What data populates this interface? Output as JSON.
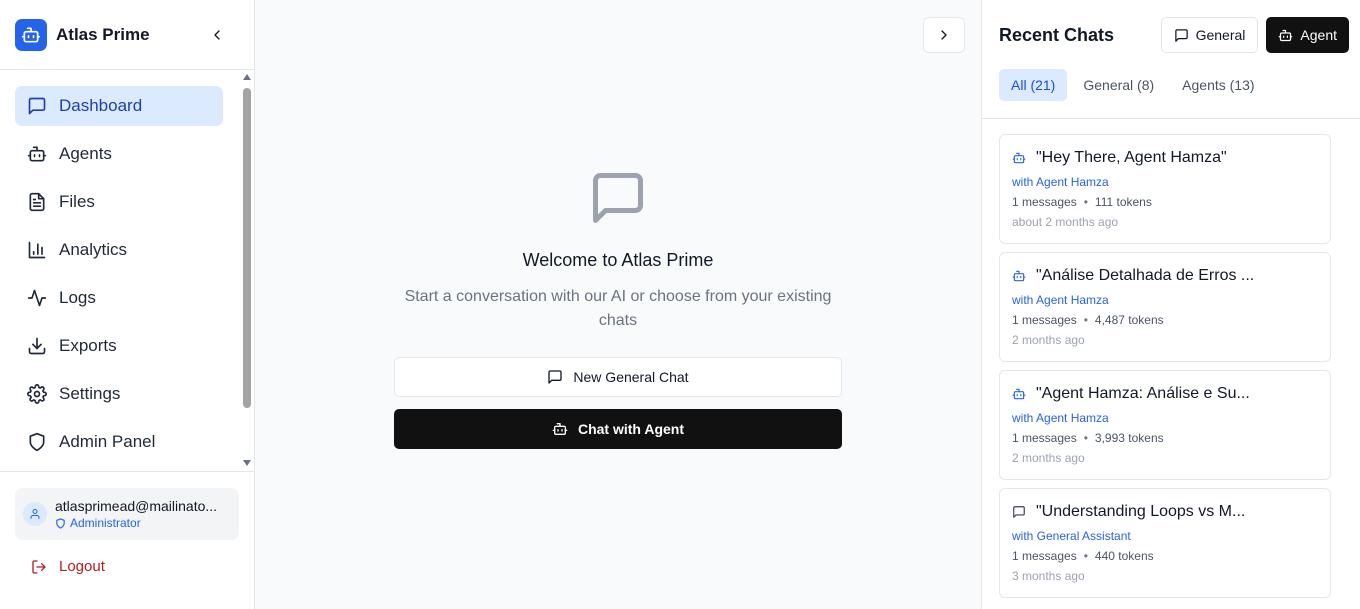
{
  "brand": {
    "name": "Atlas Prime"
  },
  "sidebar": {
    "items": [
      {
        "label": "Dashboard",
        "icon": "message-square-icon",
        "active": true
      },
      {
        "label": "Agents",
        "icon": "bot-icon"
      },
      {
        "label": "Files",
        "icon": "file-text-icon"
      },
      {
        "label": "Analytics",
        "icon": "bar-chart-icon"
      },
      {
        "label": "Logs",
        "icon": "activity-icon"
      },
      {
        "label": "Exports",
        "icon": "download-icon"
      },
      {
        "label": "Settings",
        "icon": "gear-icon"
      },
      {
        "label": "Admin Panel",
        "icon": "shield-icon"
      }
    ]
  },
  "user": {
    "email": "atlasprimead@mailinato...",
    "role": "Administrator"
  },
  "logout": {
    "label": "Logout"
  },
  "welcome": {
    "title": "Welcome to Atlas Prime",
    "subtitle": "Start a conversation with our AI or choose from your existing chats",
    "new_general_label": "New General Chat",
    "chat_agent_label": "Chat with Agent"
  },
  "panel": {
    "title": "Recent Chats",
    "general_button": "General",
    "agent_button": "Agent",
    "tabs": [
      {
        "label": "All (21)",
        "active": true
      },
      {
        "label": "General (8)"
      },
      {
        "label": "Agents (13)"
      }
    ],
    "chats": [
      {
        "kind": "agent",
        "title": "\"Hey There, Agent Hamza\"",
        "with": "with Agent Hamza",
        "messages": "1 messages",
        "tokens": "111 tokens",
        "time": "about 2 months ago"
      },
      {
        "kind": "agent",
        "title": "\"Análise Detalhada de Erros ...",
        "with": "with Agent Hamza",
        "messages": "1 messages",
        "tokens": "4,487 tokens",
        "time": "2 months ago"
      },
      {
        "kind": "agent",
        "title": "\"Agent Hamza: Análise e Su...",
        "with": "with Agent Hamza",
        "messages": "1 messages",
        "tokens": "3,993 tokens",
        "time": "2 months ago"
      },
      {
        "kind": "general",
        "title": "\"Understanding Loops vs M...",
        "with": "with General Assistant",
        "messages": "1 messages",
        "tokens": "440 tokens",
        "time": "3 months ago"
      }
    ]
  },
  "colors": {
    "brand": "#2563eb",
    "active_bg": "#dbeafe",
    "dark_button": "#111111",
    "logout": "#b91c1c"
  }
}
